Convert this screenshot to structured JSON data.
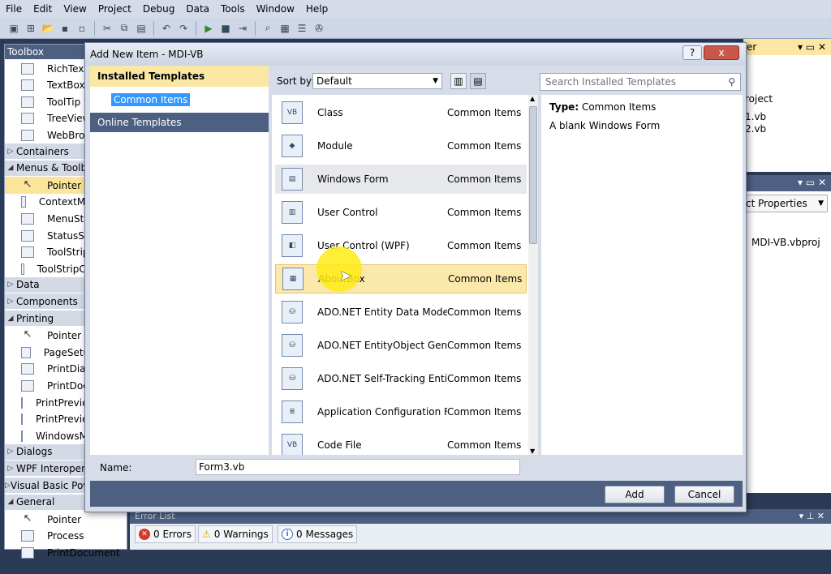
{
  "menu": [
    "File",
    "Edit",
    "View",
    "Project",
    "Debug",
    "Data",
    "Tools",
    "Window",
    "Help"
  ],
  "toolbox": {
    "title": "Toolbox",
    "rows": [
      {
        "kind": "item",
        "label": "RichTextBox",
        "icon": "rich-text-icon"
      },
      {
        "kind": "item",
        "label": "TextBox",
        "icon": "textbox-icon"
      },
      {
        "kind": "item",
        "label": "ToolTip",
        "icon": "tooltip-icon"
      },
      {
        "kind": "item",
        "label": "TreeView",
        "icon": "treeview-icon"
      },
      {
        "kind": "item",
        "label": "WebBrowser",
        "icon": "webbrowser-icon"
      },
      {
        "kind": "cat",
        "label": "Containers",
        "open": false
      },
      {
        "kind": "cat",
        "label": "Menus & Toolbars",
        "open": true
      },
      {
        "kind": "item",
        "label": "Pointer",
        "icon": "pointer-icon",
        "selected": true
      },
      {
        "kind": "item",
        "label": "ContextMenuStrip",
        "icon": "context-menu-icon"
      },
      {
        "kind": "item",
        "label": "MenuStrip",
        "icon": "menustrip-icon"
      },
      {
        "kind": "item",
        "label": "StatusStrip",
        "icon": "statusstrip-icon"
      },
      {
        "kind": "item",
        "label": "ToolStrip",
        "icon": "toolstrip-icon"
      },
      {
        "kind": "item",
        "label": "ToolStripContainer",
        "icon": "toolstrip-container-icon"
      },
      {
        "kind": "cat",
        "label": "Data",
        "open": false
      },
      {
        "kind": "cat",
        "label": "Components",
        "open": false
      },
      {
        "kind": "cat",
        "label": "Printing",
        "open": true
      },
      {
        "kind": "item",
        "label": "Pointer",
        "icon": "pointer-icon"
      },
      {
        "kind": "item",
        "label": "PageSetupDialog",
        "icon": "page-setup-icon"
      },
      {
        "kind": "item",
        "label": "PrintDialog",
        "icon": "print-dialog-icon"
      },
      {
        "kind": "item",
        "label": "PrintDocument",
        "icon": "print-document-icon"
      },
      {
        "kind": "item",
        "label": "PrintPreviewControl",
        "icon": "print-preview-control-icon"
      },
      {
        "kind": "item",
        "label": "PrintPreviewDialog",
        "icon": "print-preview-dialog-icon"
      },
      {
        "kind": "item",
        "label": "WindowsMediaPlayer",
        "icon": "media-player-icon"
      },
      {
        "kind": "cat",
        "label": "Dialogs",
        "open": false
      },
      {
        "kind": "cat",
        "label": "WPF Interoperability",
        "open": false
      },
      {
        "kind": "cat",
        "label": "Visual Basic PowerPacks",
        "open": false
      },
      {
        "kind": "cat",
        "label": "General",
        "open": true
      },
      {
        "kind": "item",
        "label": "Pointer",
        "icon": "pointer-icon"
      },
      {
        "kind": "item",
        "label": "Process",
        "icon": "process-icon"
      },
      {
        "kind": "item",
        "label": "PrintDocument",
        "icon": "print-document-icon"
      }
    ]
  },
  "solution_panel": {
    "title_fragment": "er",
    "items": [
      "roject",
      "1.vb",
      "2.vb"
    ]
  },
  "properties_panel": {
    "dropdown": "ct Properties",
    "project": "MDI-VB.vbproj"
  },
  "error_list": {
    "title": "Error List",
    "errors": "0 Errors",
    "warnings": "0 Warnings",
    "messages": "0 Messages"
  },
  "dialog": {
    "title": "Add New Item - MDI-VB",
    "help_btn": "?",
    "close_btn": "x",
    "left": {
      "installed": "Installed Templates",
      "common": "Common Items",
      "online": "Online Templates"
    },
    "sort_label": "Sort by:",
    "sort_value": "Default",
    "search_placeholder": "Search Installed Templates",
    "templates": [
      {
        "name": "Class",
        "category": "Common Items",
        "icon": "class-icon",
        "glyph": "VB"
      },
      {
        "name": "Module",
        "category": "Common Items",
        "icon": "module-icon",
        "glyph": "◆"
      },
      {
        "name": "Windows Form",
        "category": "Common Items",
        "icon": "windows-form-icon",
        "glyph": "▤",
        "state": "hover"
      },
      {
        "name": "User Control",
        "category": "Common Items",
        "icon": "user-control-icon",
        "glyph": "▥"
      },
      {
        "name": "User Control (WPF)",
        "category": "Common Items",
        "icon": "wpf-user-control-icon",
        "glyph": "◧"
      },
      {
        "name": "AboutBox",
        "category": "Common Items",
        "icon": "aboutbox-icon",
        "glyph": "▦",
        "state": "selected"
      },
      {
        "name": "ADO.NET Entity Data Model",
        "category": "Common Items",
        "icon": "entity-data-model-icon",
        "glyph": "⛁"
      },
      {
        "name": "ADO.NET EntityObject Gene...",
        "category": "Common Items",
        "icon": "entityobject-generator-icon",
        "glyph": "⛁"
      },
      {
        "name": "ADO.NET Self-Tracking Entit...",
        "category": "Common Items",
        "icon": "self-tracking-entity-icon",
        "glyph": "⛁"
      },
      {
        "name": "Application Configuration File",
        "category": "Common Items",
        "icon": "app-config-icon",
        "glyph": "≣"
      },
      {
        "name": "Code File",
        "category": "Common Items",
        "icon": "code-file-icon",
        "glyph": "VB"
      }
    ],
    "detail": {
      "type_label": "Type:",
      "type_value": "Common Items",
      "description": "A blank Windows Form"
    },
    "name_label": "Name:",
    "name_value": "Form3.vb",
    "add_btn": "Add",
    "cancel_btn": "Cancel"
  },
  "colors": {
    "selection_yellow": "#fbe9ab",
    "panel_blue": "#4d6082",
    "highlight": "#ffeb14"
  }
}
